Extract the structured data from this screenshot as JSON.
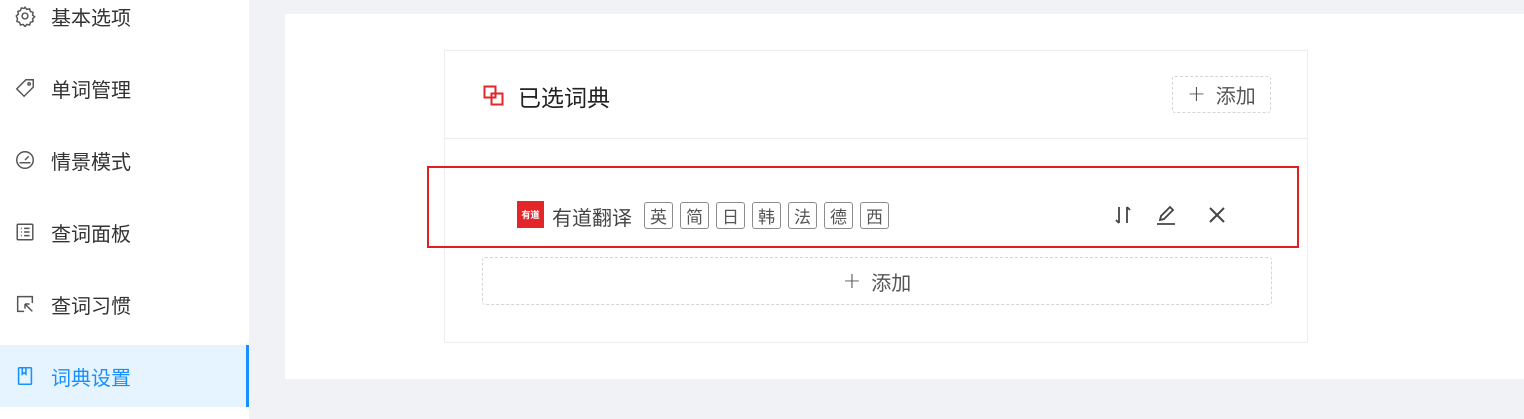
{
  "sidebar": {
    "items": [
      {
        "label": "基本选项",
        "icon": "gear-icon"
      },
      {
        "label": "单词管理",
        "icon": "tag-icon"
      },
      {
        "label": "情景模式",
        "icon": "dashboard-icon"
      },
      {
        "label": "查词面板",
        "icon": "list-panel-icon"
      },
      {
        "label": "查词习惯",
        "icon": "cursor-select-icon"
      },
      {
        "label": "词典设置",
        "icon": "book-icon",
        "active": true
      }
    ]
  },
  "card": {
    "title": "已选词典",
    "add_label": "添加",
    "bottom_add_label": "添加"
  },
  "dictionary": {
    "logo_text": "有道",
    "name": "有道翻译",
    "languages": [
      "英",
      "简",
      "日",
      "韩",
      "法",
      "德",
      "西"
    ]
  },
  "colors": {
    "accent": "#1890ff",
    "highlight": "#e02020",
    "logo": "#e3262a"
  }
}
